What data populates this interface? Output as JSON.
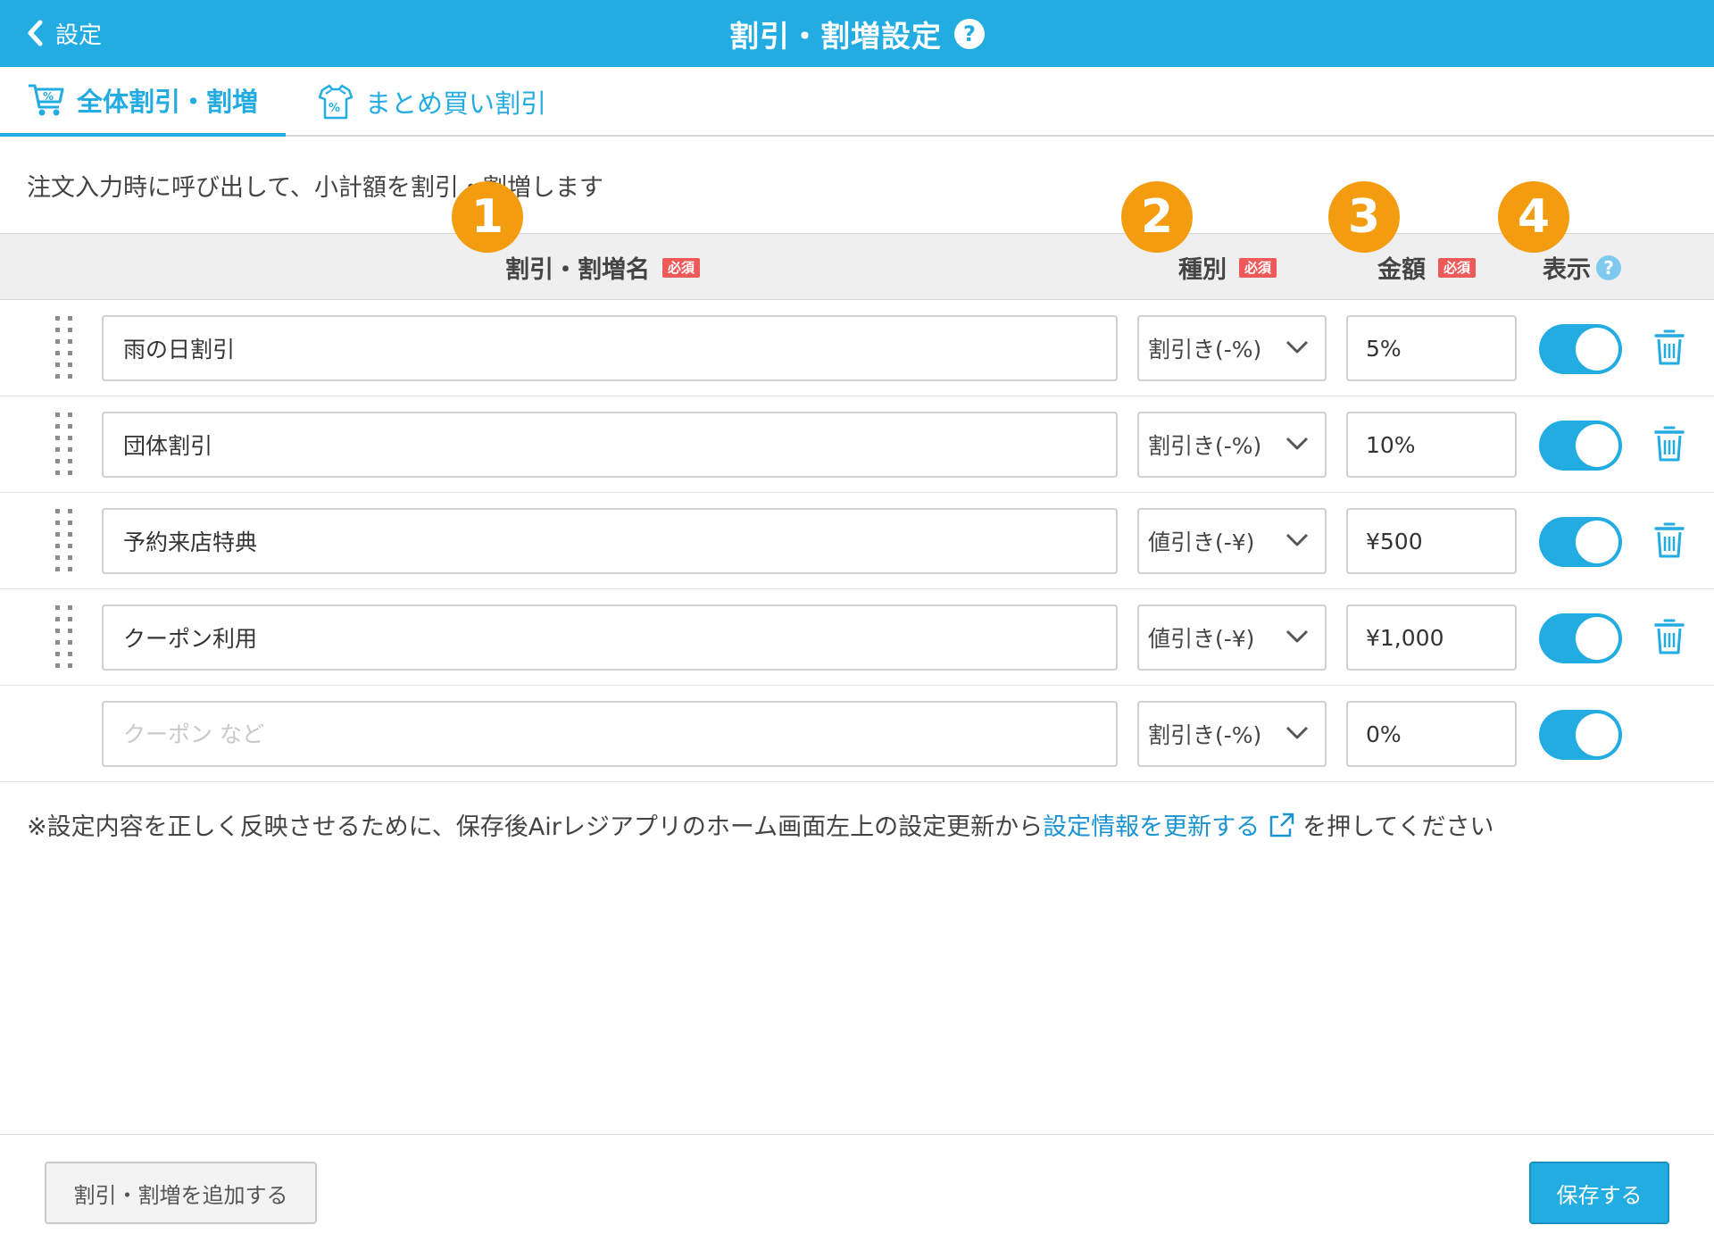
{
  "header": {
    "back_label": "設定",
    "title": "割引・割増設定",
    "help_glyph": "?"
  },
  "tabs": [
    {
      "label": "全体割引・割増",
      "active": true,
      "icon": "cart-percent-icon"
    },
    {
      "label": "まとめ買い割引",
      "active": false,
      "icon": "shirts-percent-icon"
    }
  ],
  "description": "注文入力時に呼び出して、小計額を割引・割増します",
  "badges": [
    "1",
    "2",
    "3",
    "4"
  ],
  "columns": {
    "name": "割引・割増名",
    "type": "種別",
    "amount": "金額",
    "display": "表示",
    "required": "必須",
    "help_glyph": "?"
  },
  "rows": [
    {
      "name": "雨の日割引",
      "type": "割引き(-%)",
      "amount": "5%",
      "display_on": true
    },
    {
      "name": "団体割引",
      "type": "割引き(-%)",
      "amount": "10%",
      "display_on": true
    },
    {
      "name": "予約来店特典",
      "type": "値引き(-¥)",
      "amount": "¥500",
      "display_on": true
    },
    {
      "name": "クーポン利用",
      "type": "値引き(-¥)",
      "amount": "¥1,000",
      "display_on": true
    }
  ],
  "new_row": {
    "name_value": "",
    "name_placeholder": "クーポン など",
    "type": "割引き(-%)",
    "amount": "0%",
    "display_on": true
  },
  "note": {
    "before": "※設定内容を正しく反映させるために、保存後Airレジアプリのホーム画面左上の設定更新から",
    "link": "設定情報を更新する",
    "after": "を押してください"
  },
  "footer": {
    "add_label": "割引・割増を追加する",
    "save_label": "保存する"
  },
  "colors": {
    "brand": "#22ace2",
    "badge": "#f39c0f",
    "required": "#ee5a5a",
    "link": "#1a93d0"
  }
}
